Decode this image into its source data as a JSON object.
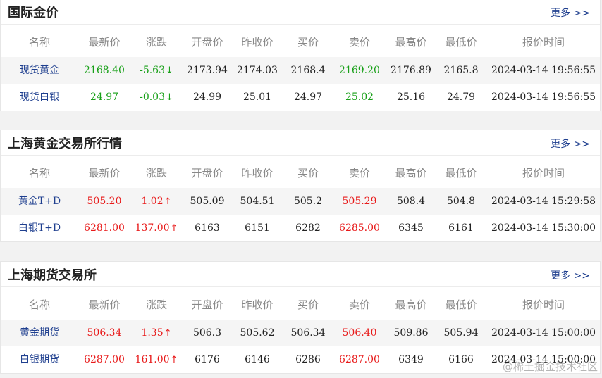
{
  "columns": [
    "名称",
    "最新价",
    "涨跌",
    "开盘价",
    "昨收价",
    "买价",
    "卖价",
    "最高价",
    "最低价",
    "报价时间"
  ],
  "more_label": "更多 >>",
  "colors": {
    "up": "#e81a1a",
    "down": "#18a018",
    "link": "#1f3f8f"
  },
  "sections": [
    {
      "title": "国际金价",
      "rows": [
        {
          "name": "现货黄金",
          "latest": "2168.40",
          "change": "-5.63",
          "arrow": "↓",
          "open": "2173.94",
          "prev_close": "2174.03",
          "bid": "2168.4",
          "ask": "2169.20",
          "high": "2176.89",
          "low": "2165.8",
          "time": "2024-03-14 19:56:55"
        },
        {
          "name": "现货白银",
          "latest": "24.97",
          "change": "-0.03",
          "arrow": "↓",
          "open": "24.99",
          "prev_close": "25.01",
          "bid": "24.97",
          "ask": "25.02",
          "high": "25.16",
          "low": "24.79",
          "time": "2024-03-14 19:56:55"
        }
      ]
    },
    {
      "title": "上海黄金交易所行情",
      "rows": [
        {
          "name": "黄金T+D",
          "latest": "505.20",
          "change": "1.02",
          "arrow": "↑",
          "open": "505.09",
          "prev_close": "504.51",
          "bid": "505.2",
          "ask": "505.29",
          "high": "508.4",
          "low": "504.8",
          "time": "2024-03-14 15:29:58"
        },
        {
          "name": "白银T+D",
          "latest": "6281.00",
          "change": "137.00",
          "arrow": "↑",
          "open": "6163",
          "prev_close": "6151",
          "bid": "6282",
          "ask": "6285.00",
          "high": "6345",
          "low": "6161",
          "time": "2024-03-14 15:30:00"
        }
      ]
    },
    {
      "title": "上海期货交易所",
      "rows": [
        {
          "name": "黄金期货",
          "latest": "506.34",
          "change": "1.35",
          "arrow": "↑",
          "open": "506.3",
          "prev_close": "505.62",
          "bid": "506.34",
          "ask": "506.40",
          "high": "509.86",
          "low": "505.94",
          "time": "2024-03-14 15:00:00"
        },
        {
          "name": "白银期货",
          "latest": "6287.00",
          "change": "161.00",
          "arrow": "↑",
          "open": "6176",
          "prev_close": "6146",
          "bid": "6286",
          "ask": "6287.00",
          "high": "6349",
          "low": "6166",
          "time": "2024-03-14 15:00:00"
        }
      ]
    }
  ],
  "watermark": "@稀土掘金技术社区"
}
